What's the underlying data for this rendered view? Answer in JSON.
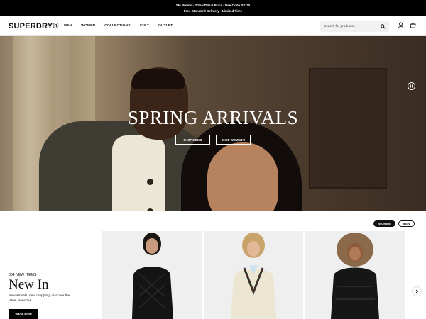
{
  "promo": {
    "line1": "Ski Promo - 20% off Full Price - Use Code SKI20",
    "line2": "Free Standard Delivery - Limited Time"
  },
  "header": {
    "logo": "SUPERDRY®",
    "menu": [
      "MEN",
      "WOMEN",
      "COLLECTIONS",
      "CULT",
      "OUTLET"
    ],
    "search_placeholder": "Search for products..."
  },
  "hero": {
    "title": "SPRING ARRIVALS",
    "cta_men": "SHOP MEN'S",
    "cta_women": "SHOP WOMEN'S"
  },
  "gender_toggle": {
    "women": "WOMEN",
    "men": "MEN",
    "selected": "WOMEN"
  },
  "new_in": {
    "count": "364 NEW ITEMS",
    "title": "New In",
    "description": "New arrivals, new dropping, discover the latest launches",
    "button": "SHOP NOW"
  },
  "colors": {
    "promo_bg": "#000000",
    "accent": "#111111",
    "card_bg": "#f0f0f0"
  }
}
